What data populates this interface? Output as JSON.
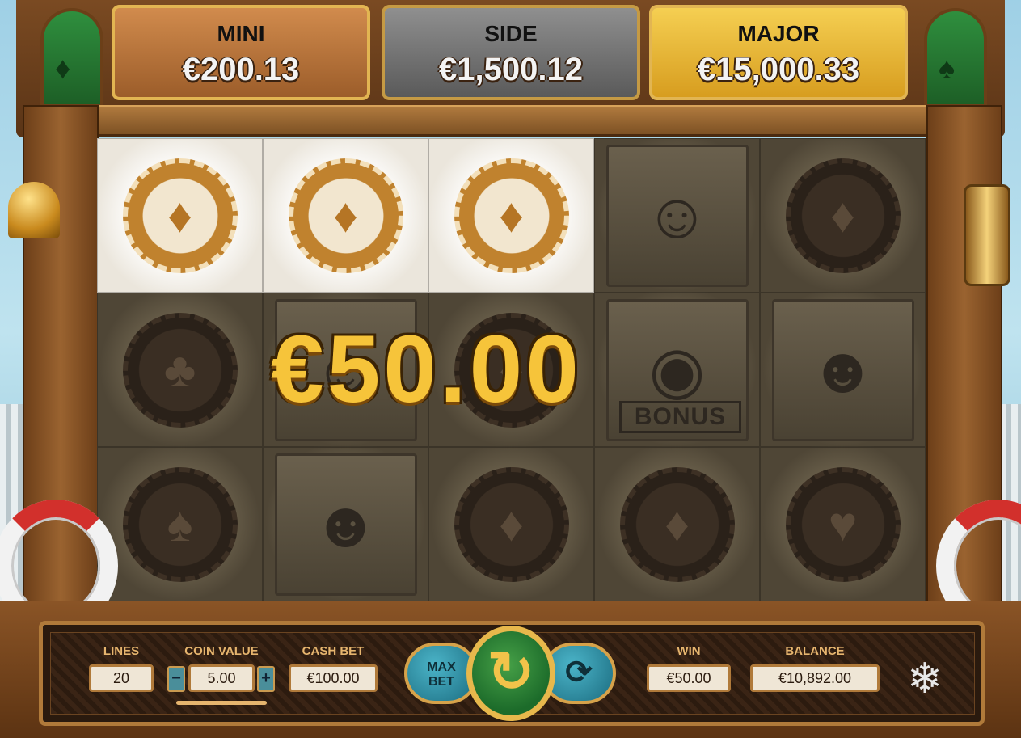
{
  "jackpots": [
    {
      "label": "MINI",
      "value": "€200.13"
    },
    {
      "label": "SIDE",
      "value": "€1,500.12"
    },
    {
      "label": "MAJOR",
      "value": "€15,000.33"
    }
  ],
  "reels": {
    "rows": [
      [
        "diamond-chip",
        "diamond-chip",
        "diamond-chip",
        "lady-portrait",
        "diamond-chip"
      ],
      [
        "club-chip",
        "lady-portrait",
        "diamond-chip",
        "bonus-coins",
        "gentleman-portrait"
      ],
      [
        "spade-chip",
        "gentleman-portrait",
        "diamond-chip",
        "diamond-chip",
        "heart-chip"
      ]
    ],
    "winning_positions": [
      [
        0,
        0
      ],
      [
        0,
        1
      ],
      [
        0,
        2
      ]
    ],
    "bonus_text": "BONUS"
  },
  "win_display": "€50.00",
  "controls": {
    "lines_label": "LINES",
    "lines_value": "20",
    "coin_value_label": "COIN VALUE",
    "coin_value": "5.00",
    "coin_minus": "−",
    "coin_plus": "+",
    "cash_bet_label": "CASH BET",
    "cash_bet_value": "€100.00",
    "max_bet_label": "MAX\nBET",
    "max_bet_line1": "MAX",
    "max_bet_line2": "BET",
    "win_label": "WIN",
    "win_value": "€50.00",
    "balance_label": "BALANCE",
    "balance_value": "€10,892.00"
  },
  "icons": {
    "spin": "refresh-icon",
    "autoplay": "autoplay-icon",
    "logo": "yggdrasil-logo-icon",
    "bell": "bell-icon",
    "lantern": "lantern-icon",
    "lifebuoy": "lifebuoy-icon"
  },
  "colors": {
    "gold": "#f6c43a",
    "mini": "#b87442",
    "side": "#777777",
    "major": "#e9b637",
    "panel_text": "#e6b56e"
  }
}
